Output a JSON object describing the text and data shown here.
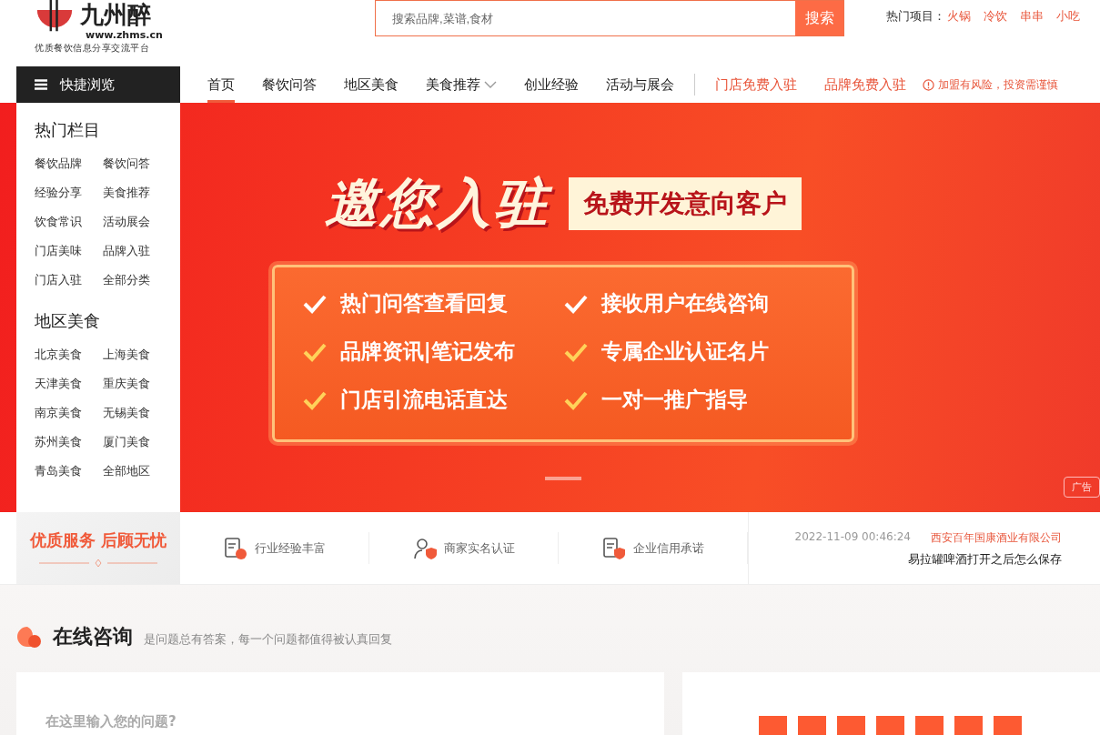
{
  "logo": {
    "name": "九州醉",
    "url": "www.zhms.cn",
    "slogan": "优质餐饮信息分享交流平台"
  },
  "search": {
    "placeholder": "搜索品牌,菜谱,食材",
    "button": "搜索"
  },
  "hot": {
    "label": "热门项目：",
    "items": [
      "火锅",
      "冷饮",
      "串串",
      "小吃"
    ]
  },
  "quick": {
    "label": "快捷浏览"
  },
  "nav": [
    {
      "label": "首页",
      "selected": true,
      "kind": "plain"
    },
    {
      "label": "餐饮问答",
      "selected": false,
      "kind": "plain"
    },
    {
      "label": "地区美食",
      "selected": false,
      "kind": "plain"
    },
    {
      "label": "美食推荐",
      "selected": false,
      "kind": "dropdown"
    },
    {
      "label": "创业经验",
      "selected": false,
      "kind": "plain"
    },
    {
      "label": "活动与展会",
      "selected": false,
      "kind": "plain"
    },
    {
      "label": "门店免费入驻",
      "selected": false,
      "kind": "promo"
    },
    {
      "label": "品牌免费入驻",
      "selected": false,
      "kind": "promo"
    }
  ],
  "notice": "加盟有风险，投资需谨慎",
  "sidebar": [
    {
      "title": "热门栏目",
      "items": [
        "餐饮品牌",
        "餐饮问答",
        "经验分享",
        "美食推荐",
        "饮食常识",
        "活动展会",
        "门店美味",
        "品牌入驻",
        "门店入驻",
        "全部分类"
      ]
    },
    {
      "title": "地区美食",
      "items": [
        "北京美食",
        "上海美食",
        "天津美食",
        "重庆美食",
        "南京美食",
        "无锡美食",
        "苏州美食",
        "厦门美食",
        "青岛美食",
        "全部地区"
      ]
    }
  ],
  "banner": {
    "headline": "邀您入驻",
    "tag": "免费开发意向客户",
    "features": [
      "热门问答查看回复",
      "接收用户在线咨询",
      "品牌资讯|笔记发布",
      "专属企业认证名片",
      "门店引流电话直达",
      "一对一推广指导"
    ],
    "ad": "广告"
  },
  "service": {
    "title": "优质服务 后顾无忧",
    "items": [
      "行业经验丰富",
      "商家实名认证",
      "企业信用承诺"
    ]
  },
  "latest": {
    "time": "2022-11-09 00:46:24",
    "company": "西安百年国康酒业有限公司",
    "question": "易拉罐啤酒打开之后怎么保存"
  },
  "consult": {
    "title": "在线咨询",
    "subtitle": "是问题总有答案，每一个问题都值得被认真回复",
    "placeholder": "在这里输入您的问题?"
  }
}
